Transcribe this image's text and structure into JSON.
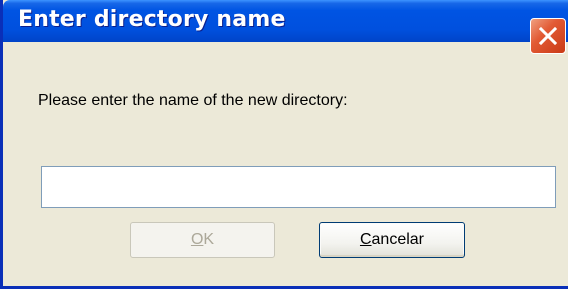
{
  "dialog": {
    "title": "Enter directory name",
    "prompt": "Please enter the name of the new directory:",
    "input_value": "",
    "input_placeholder": "",
    "ok_button": {
      "mnemonic": "O",
      "rest": "K",
      "enabled": false
    },
    "cancel_button": {
      "mnemonic": "C",
      "rest": "ancelar",
      "enabled": true
    }
  },
  "icons": {
    "close": "close-icon"
  },
  "colors": {
    "titlebar": "#0054e3",
    "close_button": "#e25a34",
    "dialog_background": "#ece9d8",
    "input_border": "#7f9db9",
    "disabled_text": "#aca899",
    "default_button_border": "#003c74"
  }
}
